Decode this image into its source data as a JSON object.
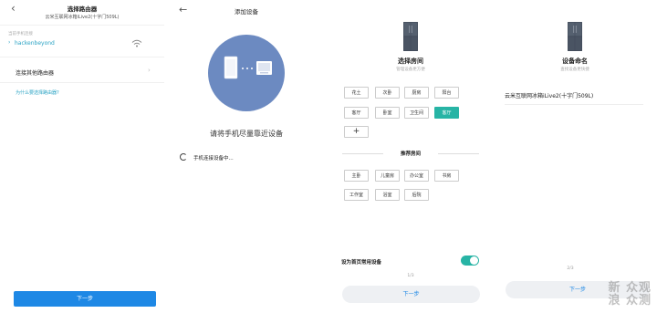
{
  "panel1": {
    "back_glyph": "‹",
    "title": "选择路由器",
    "subtitle": "云米互联网冰箱iLive2(十字门509L)",
    "current_label": "当前手机连接",
    "wifi_chevron": "›",
    "wifi_name": "hackenbeyond",
    "other_router": "连接其他路由器",
    "other_chevron": "›",
    "no_choose": "为什么要选择路由器?",
    "next": "下一步"
  },
  "panel2": {
    "back_glyph": "←",
    "title": "添加设备",
    "message": "请将手机尽量靠近设备",
    "status": "手机连接设备中..."
  },
  "panel3": {
    "title": "选择房间",
    "subtitle": "管理设备更方便",
    "rooms": [
      "花土",
      "次卧",
      "厨房",
      "阳台",
      "客厅",
      "卧室",
      "卫生间",
      "客厅"
    ],
    "selected_room": "客厅",
    "add_room": "+",
    "recommend_title": "推荐房间",
    "recommended": [
      "主卧",
      "儿童房",
      "办公室",
      "书房",
      "工作室",
      "浴室",
      "后院"
    ],
    "fav_label": "设为首页常用设备",
    "step": "1/3",
    "next": "下一步"
  },
  "panel4": {
    "title": "设备命名",
    "subtitle": "查找设备更快捷",
    "device_name": "云米互联网冰箱iLive2(十字门509L)",
    "step": "2/3",
    "next": "下一步"
  },
  "watermark": {
    "line1": "新 众观",
    "line2": "浪 众测"
  },
  "colors": {
    "accent_blue": "#1e88e5",
    "teal": "#27b4a5",
    "link": "#2aa3c4",
    "illus_blue": "#6c8ac1"
  }
}
